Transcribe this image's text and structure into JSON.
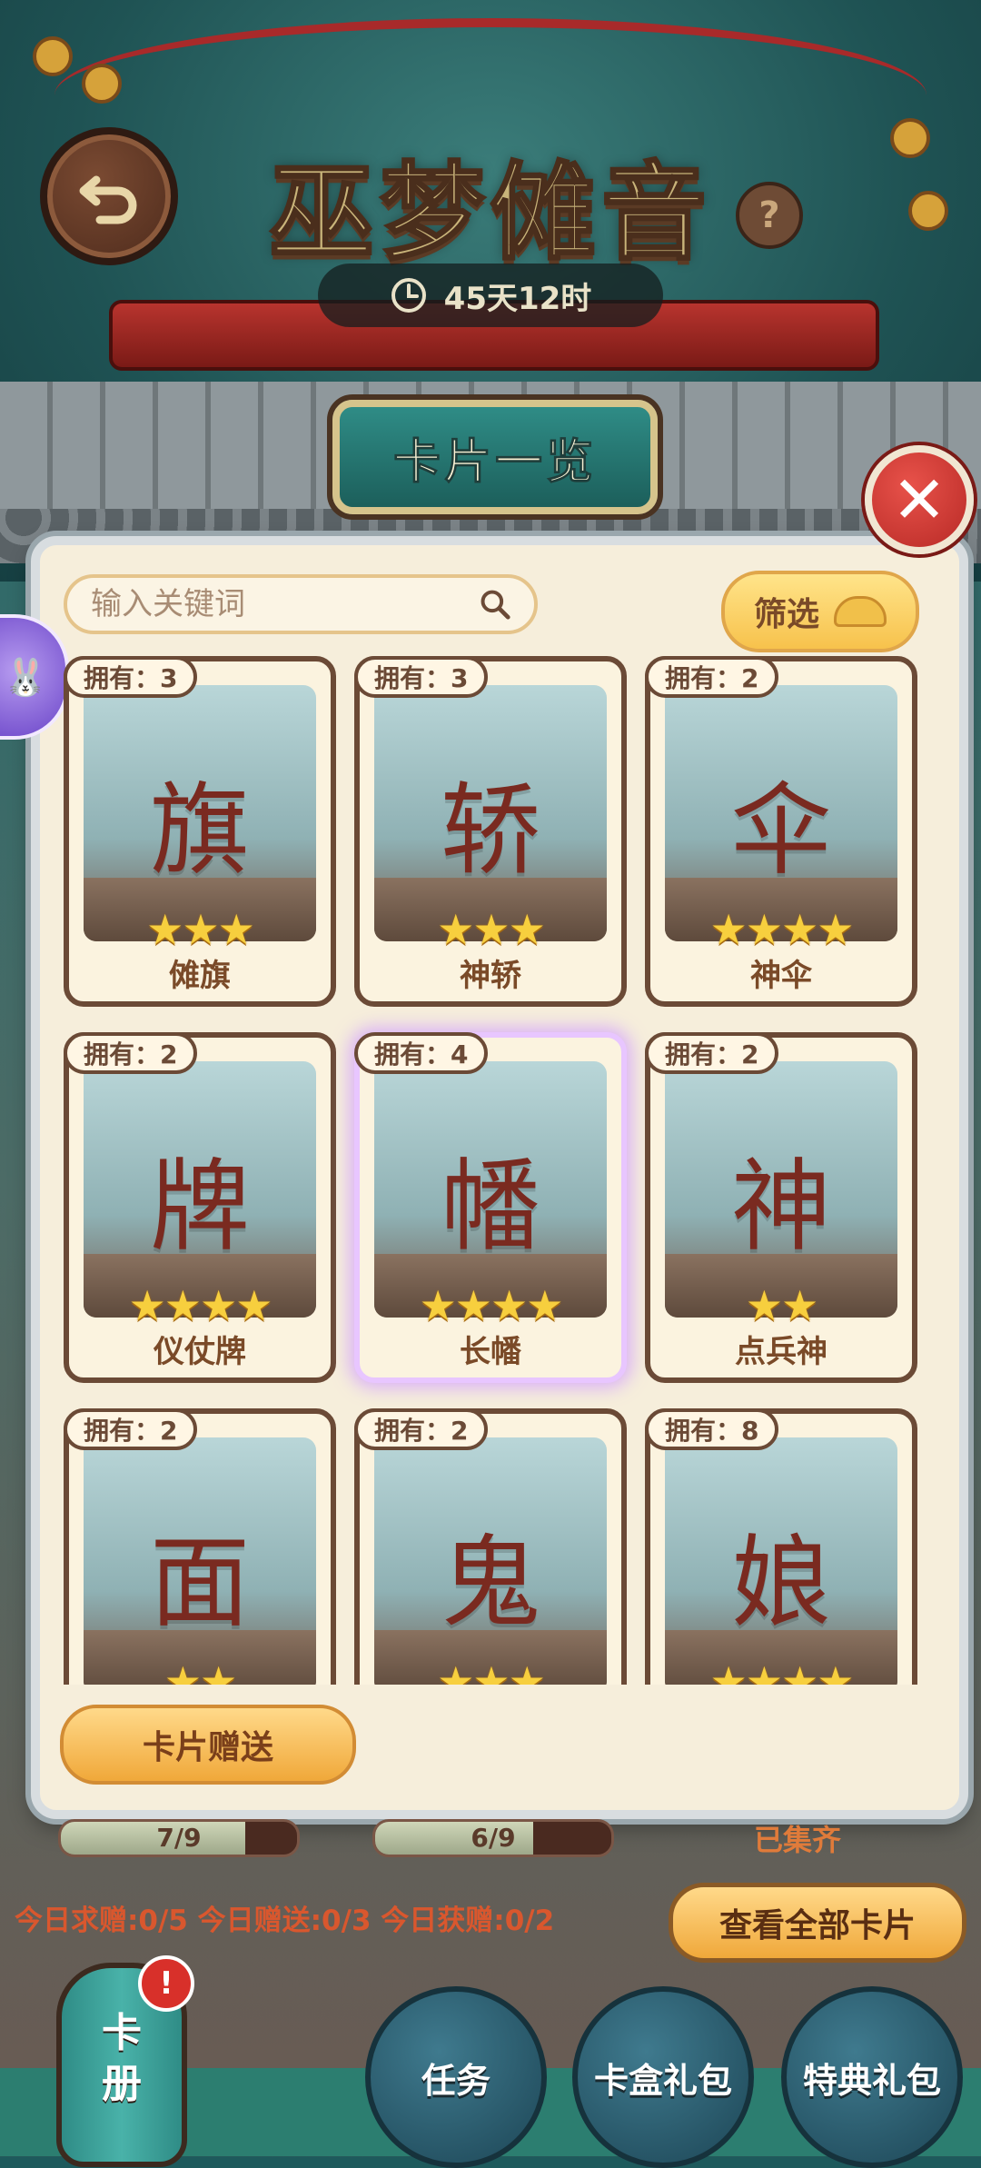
{
  "game": {
    "title": "巫梦傩音",
    "timer": "45天12时",
    "help": "?"
  },
  "panel": {
    "title": "卡片一览",
    "close": "✕",
    "search_placeholder": "输入关键词",
    "filter_label": "筛选",
    "gift_button": "卡片赠送"
  },
  "cards": [
    {
      "owned": "拥有：3",
      "name": "傩旗",
      "stars": "★★★",
      "glyph": "旗"
    },
    {
      "owned": "拥有：3",
      "name": "神轿",
      "stars": "★★★",
      "glyph": "轿"
    },
    {
      "owned": "拥有：2",
      "name": "神伞",
      "stars": "★★★★",
      "glyph": "伞"
    },
    {
      "owned": "拥有：2",
      "name": "仪仗牌",
      "stars": "★★★★",
      "glyph": "牌"
    },
    {
      "owned": "拥有：4",
      "name": "长幡",
      "stars": "★★★★",
      "glyph": "幡"
    },
    {
      "owned": "拥有：2",
      "name": "点兵神",
      "stars": "★★",
      "glyph": "神"
    },
    {
      "owned": "拥有：2",
      "name": "",
      "stars": "★★",
      "glyph": "面"
    },
    {
      "owned": "拥有：2",
      "name": "",
      "stars": "★★★",
      "glyph": "鬼"
    },
    {
      "owned": "拥有：8",
      "name": "",
      "stars": "★★★★",
      "glyph": "娘"
    }
  ],
  "bottom": {
    "progress": [
      {
        "text": "7/9",
        "value": 0.78
      },
      {
        "text": "6/9",
        "value": 0.67
      }
    ],
    "collected": "已集齐",
    "daily": "今日求赠:0/5 今日赠送:0/3 今日获赠:0/2",
    "view_all": "查看全部卡片",
    "lantern": "卡册",
    "alert": "!",
    "tabs": [
      "任务",
      "卡盒礼包",
      "特典礼包"
    ]
  },
  "colors": {
    "accent": "#f0a83a",
    "teal": "#2f8c86",
    "red": "#b82a26",
    "brown": "#6b4a36"
  }
}
